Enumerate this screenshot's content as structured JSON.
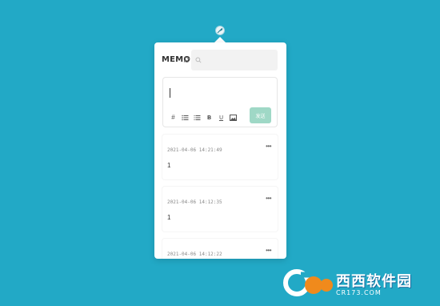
{
  "app": {
    "logo": "MEMO",
    "accent_color": "#9fd8c6",
    "background_color": "#22a9c6"
  },
  "search": {
    "placeholder": ""
  },
  "editor": {
    "value": "",
    "toolbar": {
      "tag": "#",
      "unordered_list": "unordered-list-icon",
      "ordered_list": "ordered-list-icon",
      "bold": "B",
      "underline": "U",
      "image": "image-icon"
    },
    "send_label": "发送"
  },
  "memos": [
    {
      "time": "2021-04-06 14:21:49",
      "content": "1",
      "more": "•••"
    },
    {
      "time": "2021-04-06 14:12:35",
      "content": "1",
      "more": "•••"
    },
    {
      "time": "2021-04-06 14:12:22",
      "content": "",
      "more": "•••"
    }
  ],
  "watermark": {
    "cn": "西西软件园",
    "en": "CR173.COM"
  }
}
